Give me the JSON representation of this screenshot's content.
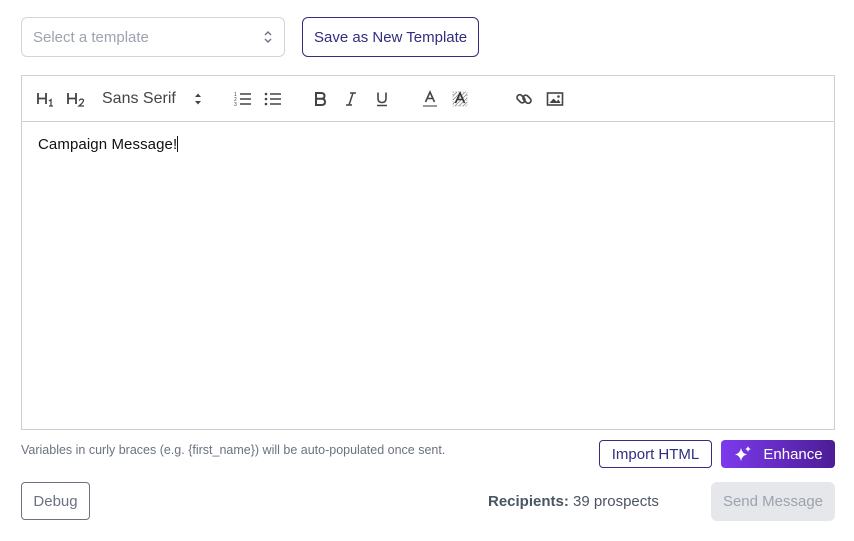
{
  "template_select": {
    "placeholder": "Select a template",
    "icon": "chevron-updown-icon"
  },
  "save_template_button": {
    "label": "Save as New Template"
  },
  "toolbar": {
    "font_family": "Sans Serif",
    "buttons": [
      "heading-1-icon",
      "heading-2-icon",
      "ordered-list-icon",
      "bullet-list-icon",
      "bold-icon",
      "italic-icon",
      "underline-icon",
      "text-color-icon",
      "background-color-icon",
      "link-icon",
      "image-icon"
    ]
  },
  "editor": {
    "content": "Campaign Message!"
  },
  "hint": {
    "text": "Variables in curly braces (e.g. {first_name}) will be auto-populated once sent."
  },
  "import_button": {
    "label": "Import HTML"
  },
  "enhance_button": {
    "label": "Enhance",
    "icon": "sparkle-icon"
  },
  "debug_button": {
    "label": "Debug"
  },
  "recipients": {
    "label": "Recipients:",
    "value": "39 prospects"
  },
  "send_button": {
    "label": "Send Message",
    "disabled": true
  },
  "colors": {
    "accent": "#312e81",
    "enhance_start": "#7c3aed",
    "enhance_end": "#4c1d95",
    "disabled_bg": "#e5e7eb"
  }
}
